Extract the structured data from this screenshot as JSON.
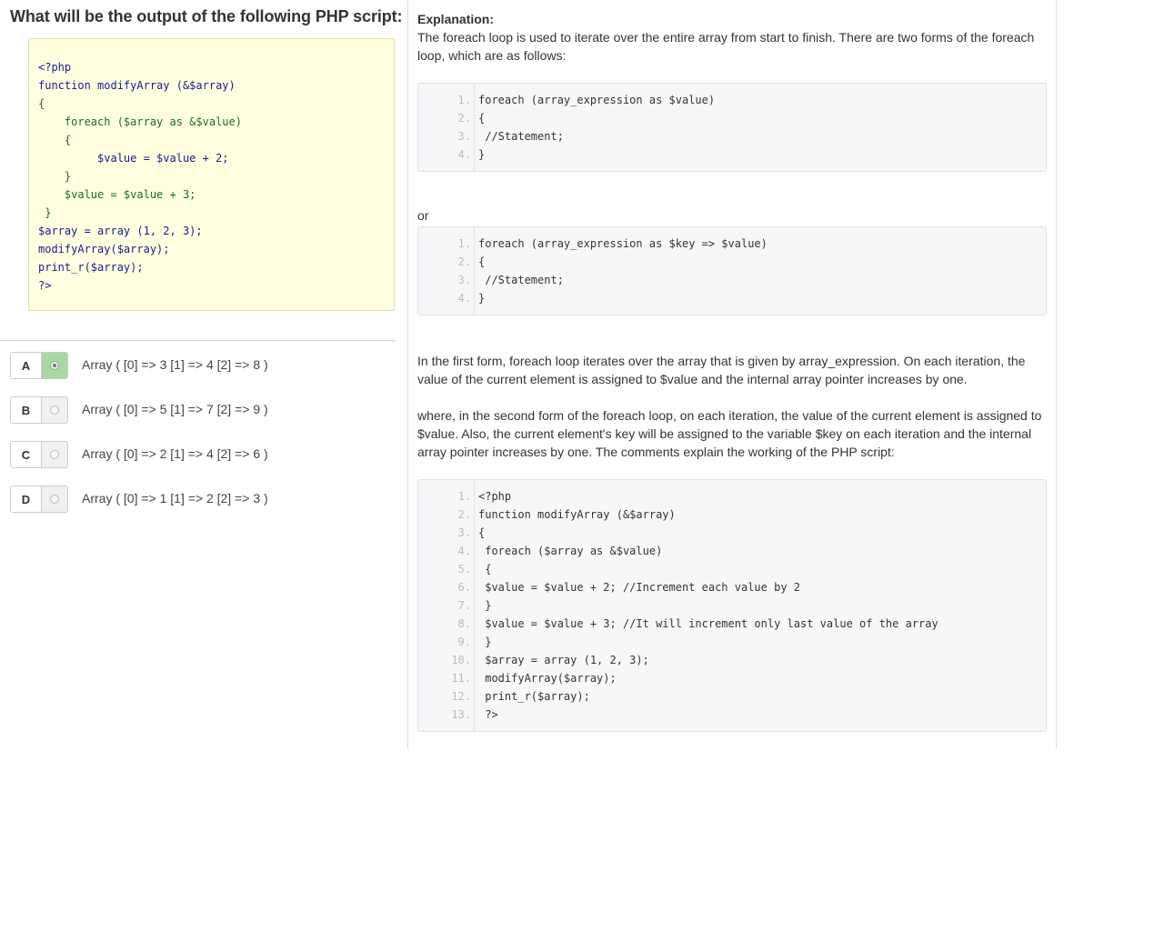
{
  "question": {
    "title": "What will be the output of the following PHP script:",
    "code_lines": [
      "<?php",
      "function modifyArray (&$array)",
      "{",
      "    foreach ($array as &$value)",
      "    {",
      "         $value = $value + 2;",
      "    }",
      "    $value = $value + 3;",
      " }",
      "$array = array (1, 2, 3);",
      "modifyArray($array);",
      "print_r($array);",
      "?>"
    ]
  },
  "options": [
    {
      "letter": "A",
      "text": "Array ( [0] => 3 [1] => 4 [2] => 8 )",
      "selected": true
    },
    {
      "letter": "B",
      "text": "Array ( [0] => 5 [1] => 7 [2] => 9 )",
      "selected": false
    },
    {
      "letter": "C",
      "text": "Array ( [0] => 2 [1] => 4 [2] => 6 )",
      "selected": false
    },
    {
      "letter": "D",
      "text": "Array ( [0] => 1 [1] => 2 [2] => 3 )",
      "selected": false
    }
  ],
  "explanation": {
    "title": "Explanation:",
    "intro": "The foreach loop is used to iterate over the entire array from start to finish. There are two forms of the foreach loop, which are as follows:",
    "code1": [
      "foreach (array_expression as $value)",
      "{",
      " //Statement;",
      "}"
    ],
    "or_text": "or",
    "code2": [
      "foreach (array_expression as $key => $value)",
      "{",
      " //Statement;",
      "}"
    ],
    "para1": "In the first form, foreach loop iterates over the array that is given by array_expression. On each iteration, the value of the current element is assigned to $value and the internal array pointer increases by one.",
    "para2": "where, in the second form of the foreach loop, on each iteration, the value of the current element is assigned to $value. Also, the current element's key will be assigned to the variable $key on each iteration and the internal array pointer increases by one. The comments explain the working of the PHP script:",
    "code3": [
      "<?php",
      "function modifyArray (&$array)",
      "{",
      " foreach ($array as &$value)",
      " {",
      " $value = $value + 2; //Increment each value by 2",
      " }",
      " $value = $value + 3; //It will increment only last value of the array",
      " }",
      " $array = array (1, 2, 3);",
      " modifyArray($array);",
      " print_r($array);",
      " ?>"
    ]
  }
}
